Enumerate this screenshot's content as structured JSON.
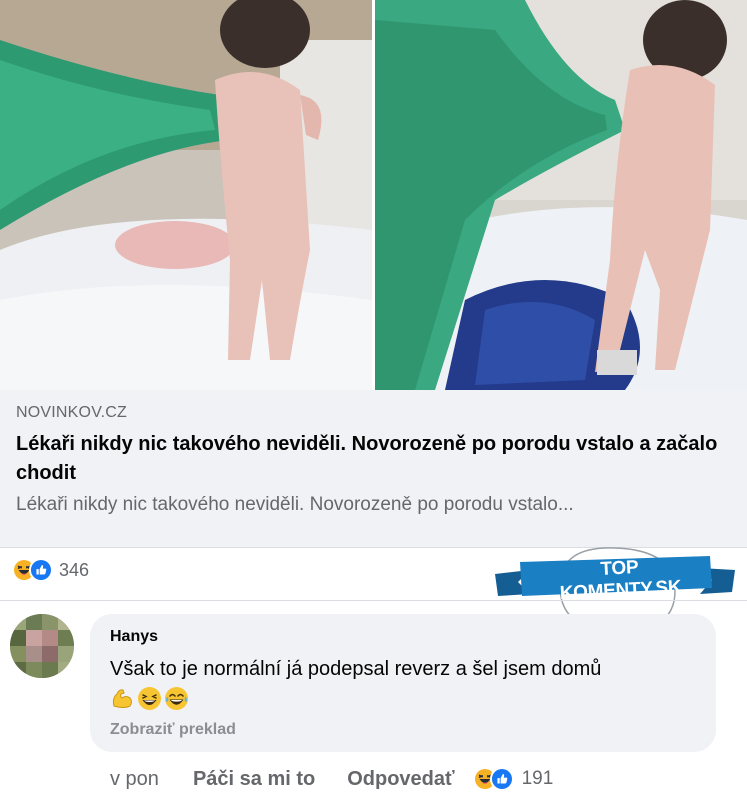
{
  "link_preview": {
    "domain": "NOVINKOV.CZ",
    "title": "Lékaři nikdy nic takového neviděli. Novorozeně po porodu vstalo a začalo chodit",
    "description": "Lékaři nikdy nic takového neviděli. Novorozeně po porodu vstalo..."
  },
  "post_reactions": {
    "icons": [
      "haha-icon",
      "like-icon"
    ],
    "count": "346"
  },
  "badge": {
    "label": "TOP KOMENTY.SK",
    "color": "#1b7fc4"
  },
  "comment": {
    "author": "Hanys",
    "text": "Však to je normální já podepsal reverz a šel jsem domů",
    "emojis": [
      "flexed-biceps-icon",
      "grinning-squinting-face-icon",
      "tears-of-joy-face-icon"
    ],
    "translate_label": "Zobraziť preklad",
    "time": "v pon",
    "like_label": "Páči sa mi to",
    "reply_label": "Odpovedať",
    "reaction_icons": [
      "haha-icon",
      "like-icon"
    ],
    "reaction_count": "191"
  },
  "colors": {
    "fb_blue": "#1877f2",
    "haha_yellow": "#f7b125",
    "bubble_bg": "#f0f2f5",
    "scrub_green": "#2aa27a"
  }
}
